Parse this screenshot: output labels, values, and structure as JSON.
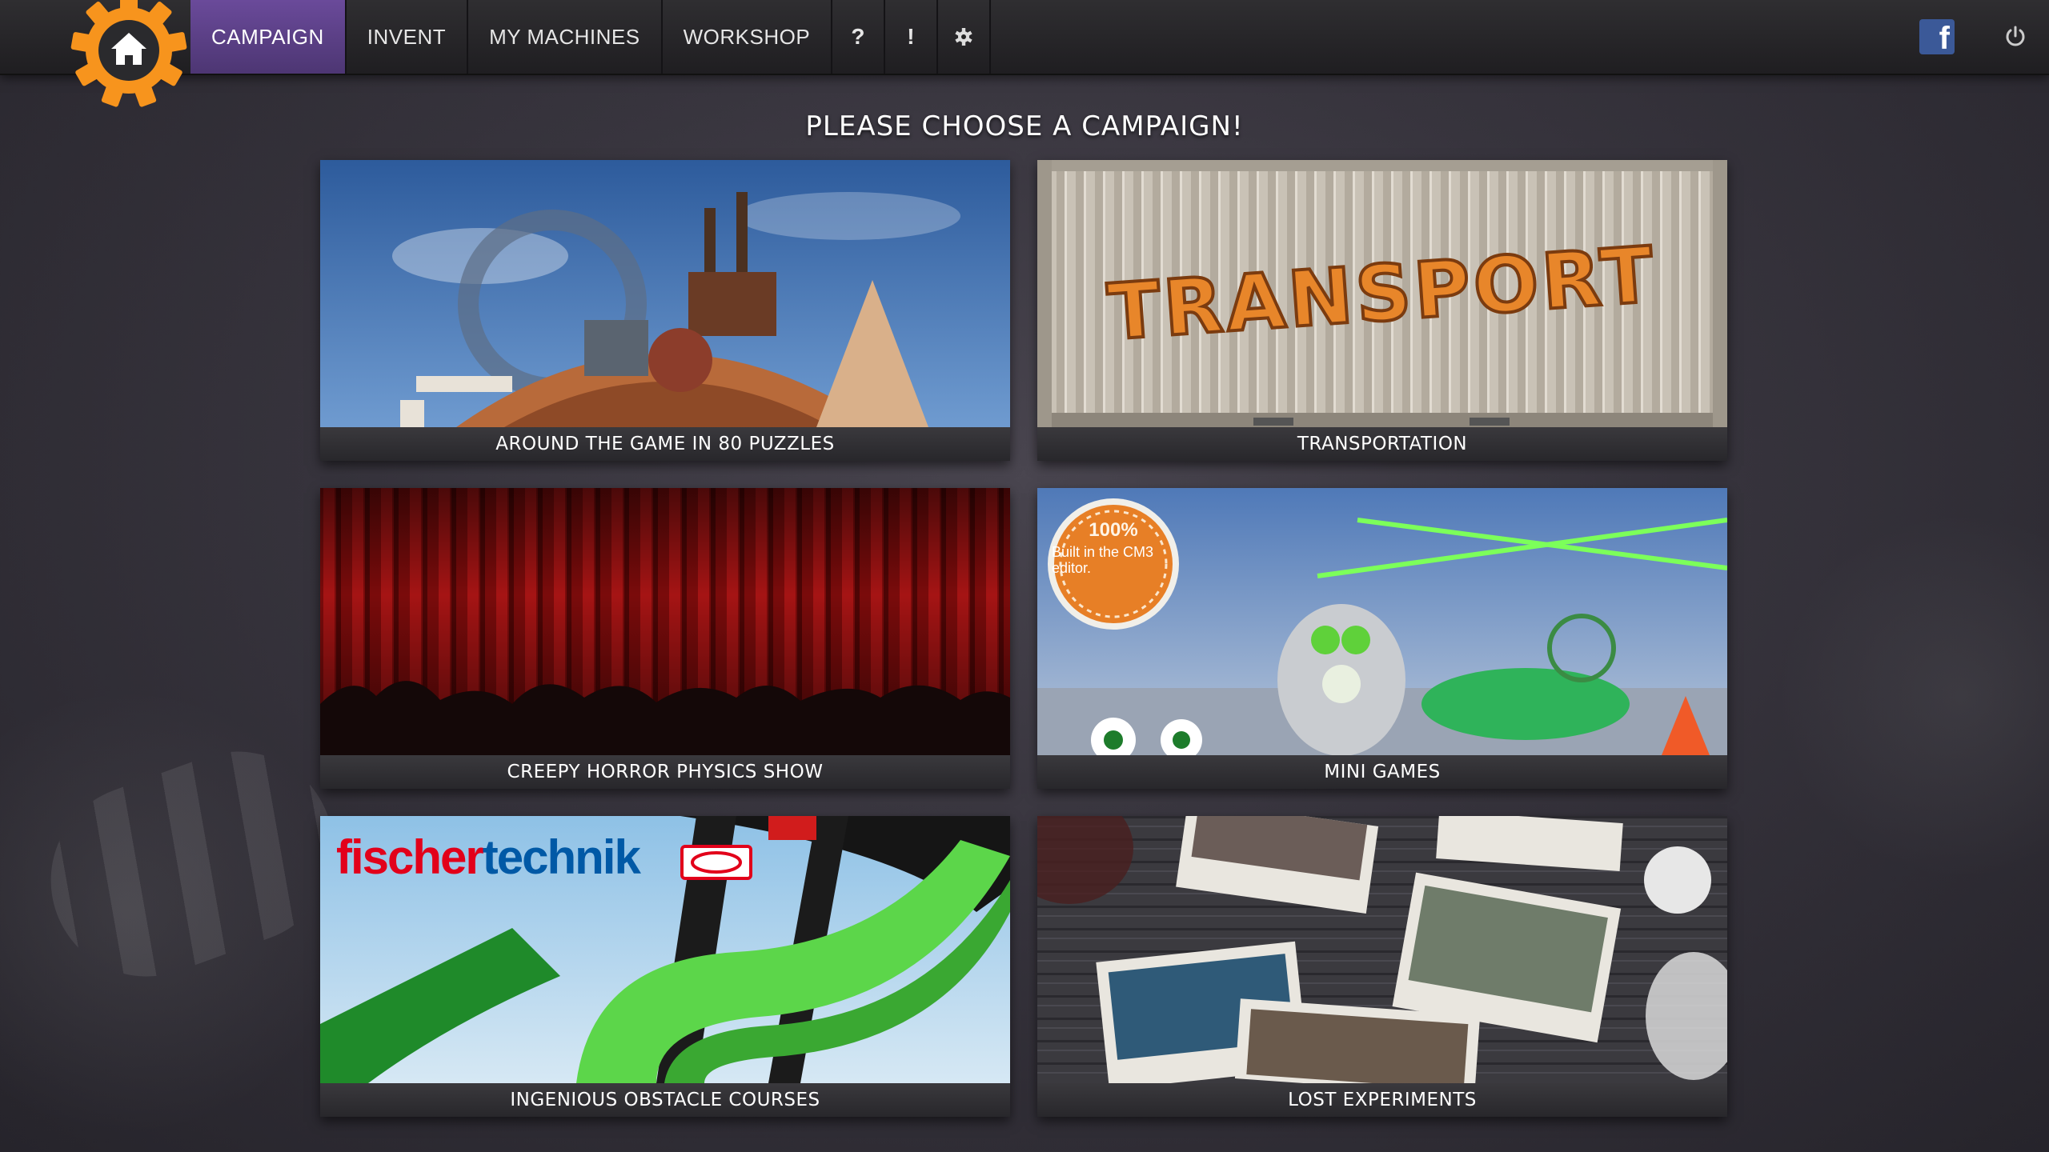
{
  "nav": {
    "items": [
      {
        "label": "CAMPAIGN",
        "active": true
      },
      {
        "label": "INVENT",
        "active": false
      },
      {
        "label": "MY MACHINES",
        "active": false
      },
      {
        "label": "WORKSHOP",
        "active": false
      }
    ],
    "help_label": "?",
    "news_label": "!",
    "icons": [
      "home-gear-icon",
      "help-icon",
      "news-icon",
      "settings-gear-icon",
      "facebook-icon",
      "power-icon"
    ],
    "accent": "#5a3d86",
    "gear_color": "#f7941d"
  },
  "page": {
    "title": "PLEASE CHOOSE A CAMPAIGN!"
  },
  "campaigns": [
    {
      "label": "AROUND THE GAME IN 80 PUZZLES"
    },
    {
      "label": "TRANSPORTATION",
      "image_text": "TRANSPORT"
    },
    {
      "label": "CREEPY HORROR PHYSICS SHOW"
    },
    {
      "label": "MINI GAMES",
      "badge_top": "100%",
      "badge_text": "Built in the CM3 editor."
    },
    {
      "label": "INGENIOUS OBSTACLE COURSES",
      "logo_part1": "fischer",
      "logo_part2": "technik"
    },
    {
      "label": "LOST EXPERIMENTS"
    }
  ]
}
